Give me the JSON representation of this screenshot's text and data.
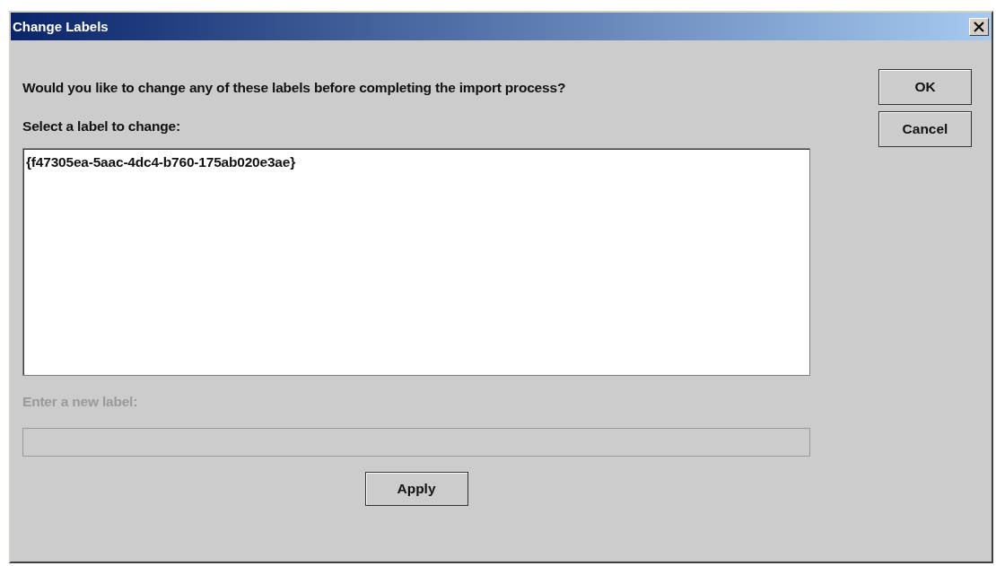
{
  "window": {
    "title": "Change Labels"
  },
  "prompt": "Would you like to change any of these labels before completing the import process?",
  "list_label": "Select a label to change:",
  "labels": [
    {
      "text": "{f47305ea-5aac-4dc4-b760-175ab020e3ae}",
      "selected": false
    }
  ],
  "new_label": {
    "label": "Enter a new label:",
    "disabled": true
  },
  "apply_button": "Apply",
  "buttons": [
    "OK",
    "Cancel"
  ]
}
